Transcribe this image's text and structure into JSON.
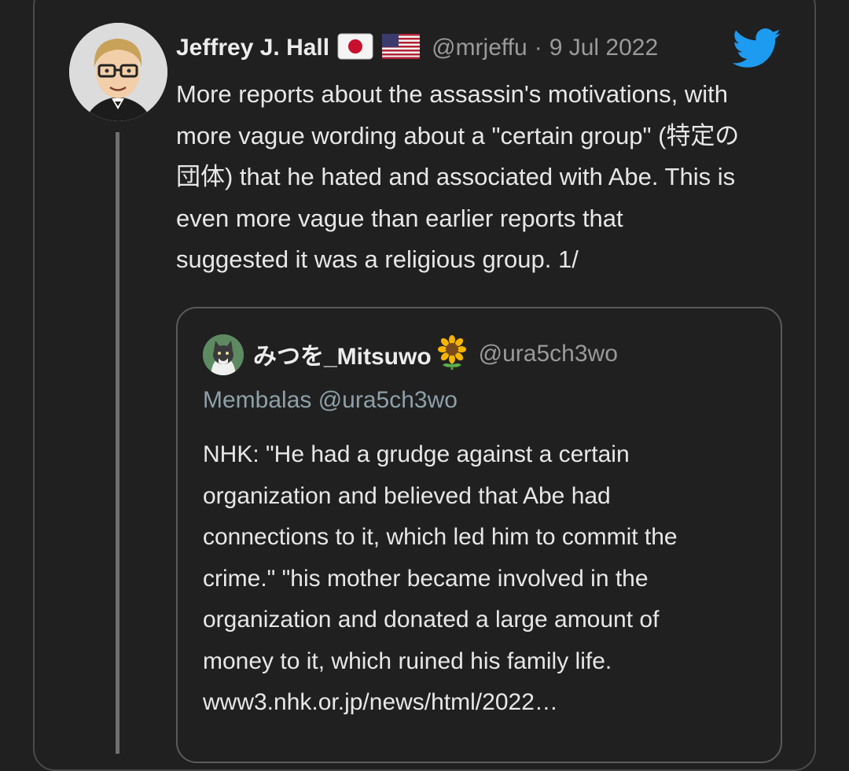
{
  "tweet": {
    "author_name": "Jeffrey J. Hall",
    "flags": [
      "japan-flag-icon",
      "us-flag-icon"
    ],
    "handle": "@mrjeffu",
    "separator": "·",
    "date": "9 Jul 2022",
    "source_icon": "twitter-bird-icon",
    "text_lines": [
      "More reports about the assassin's motivations, with",
      "more vague wording about a \"certain group\" (特定の",
      "団体) that he hated and associated with Abe. This is",
      "even more vague than earlier reports that",
      "suggested it was a religious group. 1/"
    ]
  },
  "quoted_tweet": {
    "author_name": "みつを_Mitsuwo",
    "name_emoji": "sunflower-icon",
    "handle": "@ura5ch3wo",
    "reply_context": "Membalas @ura5ch3wo",
    "text_lines": [
      "NHK: \"He had a grudge against a certain",
      "organization and believed that Abe had",
      "connections to it, which led him to commit the",
      "crime.\"  \"his mother became involved in the",
      "organization and donated a large amount of",
      "money to it, which ruined his family life.",
      "www3.nhk.or.jp/news/html/2022…"
    ]
  },
  "colors": {
    "background": "#202020",
    "border": "#4a4a4a",
    "twitter_blue": "#1d9bf0",
    "muted_text": "#9a9a9a",
    "reply_text": "#8ea0a8"
  }
}
